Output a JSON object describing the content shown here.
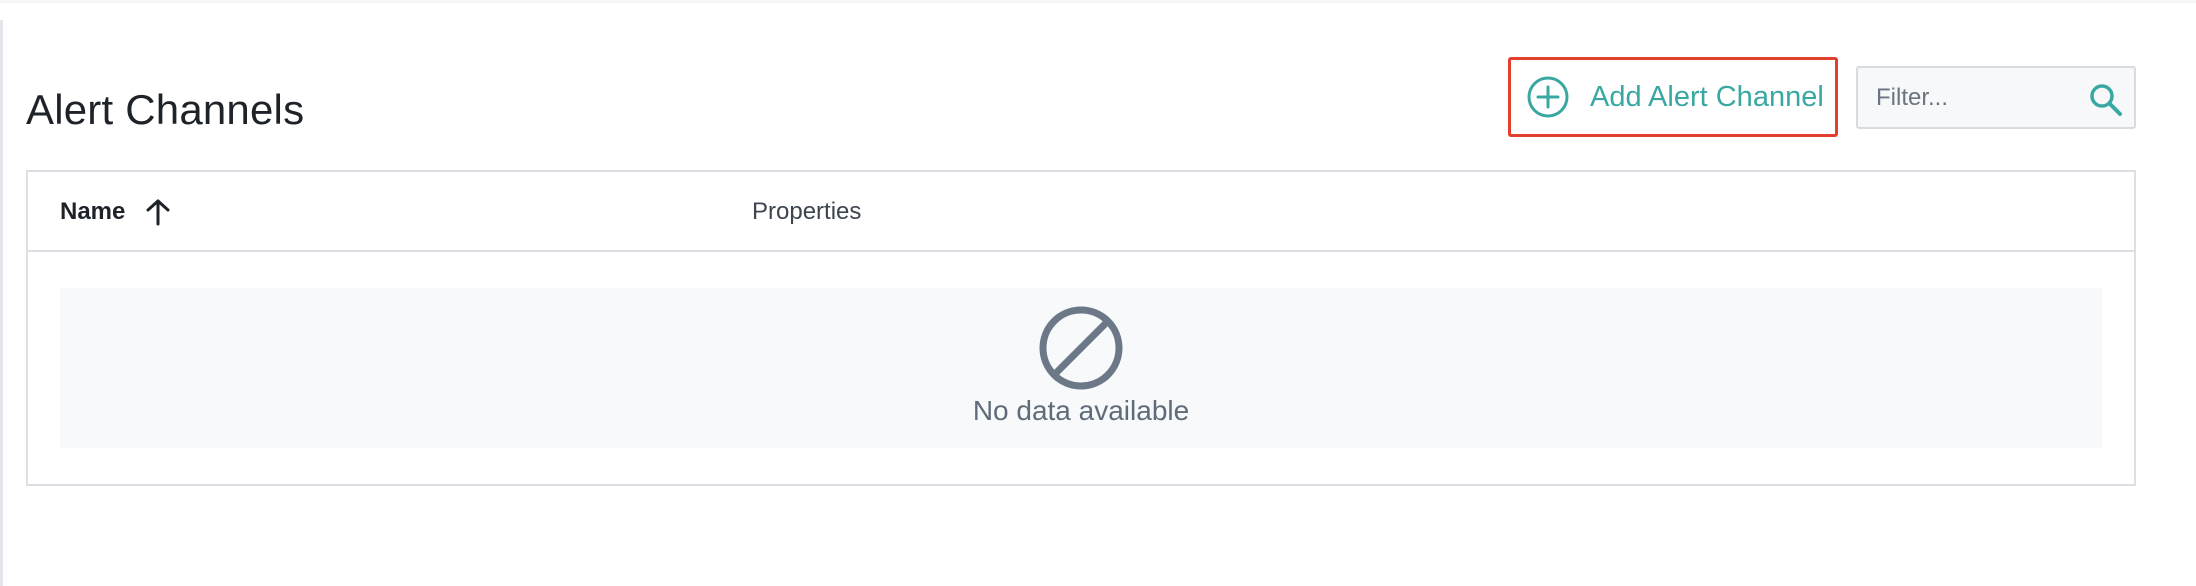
{
  "page": {
    "title": "Alert Channels"
  },
  "toolbar": {
    "add_button_label": "Add Alert Channel",
    "filter_placeholder": "Filter...",
    "filter_value": ""
  },
  "table": {
    "columns": [
      {
        "label": "Name",
        "sort": "ascending"
      },
      {
        "label": "Properties"
      }
    ],
    "rows": [],
    "empty_message": "No data available"
  },
  "icons": {
    "add": "plus-circle-icon",
    "search": "search-icon",
    "sort": "arrow-up-icon",
    "empty": "no-entry-icon"
  },
  "colors": {
    "accent": "#3aa8a2",
    "highlight_border": "#e2402f",
    "empty_icon": "#6c7888",
    "empty_background": "#f7f9fb"
  }
}
